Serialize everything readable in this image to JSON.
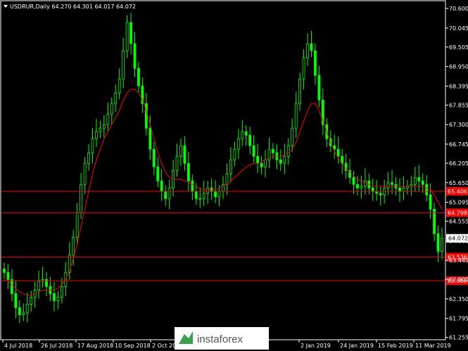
{
  "chart_data": {
    "type": "candlestick",
    "title": "USDRUR,Daily  64.270 64.301 64.017 64.072",
    "ylim": [
      61.25,
      70.6
    ],
    "y_ticks": [
      "70.600",
      "70.045",
      "69.505",
      "68.950",
      "68.395",
      "67.855",
      "67.300",
      "66.745",
      "66.205",
      "65.650",
      "65.095",
      "64.555",
      "64.000",
      "63.445",
      "62.905",
      "62.350",
      "61.795",
      "61.255"
    ],
    "x_ticks": [
      "4 Jul 2018",
      "26 Jul 2018",
      "17 Aug 2018",
      "10 Sep 2018",
      "2 Oct 2018",
      "",
      "2 Jan 2019",
      "24 Jan 2019",
      "15 Feb 2019",
      "11 Mar 2019"
    ],
    "current_price": "64.072",
    "levels": [
      {
        "value": 65.406,
        "label": "65.406"
      },
      {
        "value": 64.798,
        "label": "64.798"
      },
      {
        "value": 63.536,
        "label": "63.536"
      },
      {
        "value": 62.866,
        "label": "62.866"
      }
    ],
    "close_series": [
      63.1,
      62.9,
      62.5,
      62.1,
      61.9,
      61.95,
      62.2,
      62.4,
      62.6,
      62.85,
      62.9,
      62.7,
      62.5,
      62.3,
      62.4,
      62.7,
      63.1,
      63.6,
      64.1,
      64.8,
      65.6,
      66.2,
      66.5,
      66.9,
      67.1,
      67.2,
      67.3,
      67.6,
      67.9,
      68.2,
      68.6,
      69.4,
      70.2,
      69.6,
      68.9,
      68.4,
      67.9,
      67.2,
      66.6,
      66.1,
      65.7,
      65.4,
      65.2,
      65.5,
      66.0,
      66.4,
      66.7,
      66.2,
      65.7,
      65.4,
      65.2,
      65.2,
      65.35,
      65.5,
      65.4,
      65.25,
      65.4,
      65.6,
      65.9,
      66.3,
      66.6,
      66.9,
      67.1,
      67.0,
      66.7,
      66.4,
      66.2,
      66.1,
      66.3,
      66.6,
      66.5,
      66.3,
      66.2,
      66.4,
      66.7,
      67.2,
      67.9,
      68.6,
      69.2,
      69.6,
      69.4,
      68.7,
      68.0,
      67.3,
      66.9,
      66.7,
      66.6,
      66.4,
      66.2,
      66.0,
      65.8,
      65.6,
      65.5,
      65.55,
      65.7,
      65.5,
      65.4,
      65.35,
      65.3,
      65.5,
      65.65,
      65.6,
      65.5,
      65.4,
      65.5,
      65.55,
      65.6,
      65.8,
      65.7,
      65.6,
      65.3,
      64.9,
      64.2,
      63.7,
      64.072
    ],
    "ma_series": [
      62.9,
      62.85,
      62.75,
      62.65,
      62.55,
      62.5,
      62.45,
      62.45,
      62.5,
      62.55,
      62.6,
      62.6,
      62.6,
      62.6,
      62.65,
      62.75,
      62.9,
      63.15,
      63.5,
      63.9,
      64.4,
      64.9,
      65.4,
      65.9,
      66.3,
      66.6,
      66.9,
      67.1,
      67.3,
      67.5,
      67.7,
      68.0,
      68.2,
      68.3,
      68.3,
      68.2,
      68.0,
      67.7,
      67.3,
      66.9,
      66.5,
      66.2,
      65.95,
      65.8,
      65.75,
      65.75,
      65.75,
      65.7,
      65.65,
      65.6,
      65.55,
      65.5,
      65.45,
      65.45,
      65.45,
      65.45,
      65.5,
      65.55,
      65.6,
      65.7,
      65.8,
      65.9,
      66.0,
      66.1,
      66.15,
      66.2,
      66.2,
      66.25,
      66.3,
      66.35,
      66.4,
      66.4,
      66.4,
      66.45,
      66.5,
      66.6,
      66.8,
      67.1,
      67.4,
      67.7,
      67.9,
      67.9,
      67.7,
      67.4,
      67.1,
      66.8,
      66.55,
      66.35,
      66.2,
      66.05,
      65.95,
      65.85,
      65.75,
      65.7,
      65.65,
      65.6,
      65.55,
      65.55,
      65.55,
      65.55,
      65.55,
      65.55,
      65.55,
      65.55,
      65.55,
      65.55,
      65.55,
      65.55,
      65.55,
      65.55,
      65.5,
      65.45,
      65.3,
      65.1,
      64.9
    ],
    "colors": {
      "bull": "#00ff00",
      "bear": "#00ff00",
      "ma": "#ff0000",
      "level": "#ff0000",
      "background": "#000000",
      "axis": "#ffffff",
      "price_box": "#ffffff"
    }
  },
  "watermark": {
    "brand": "instaforex"
  }
}
